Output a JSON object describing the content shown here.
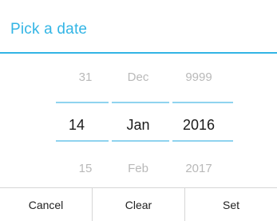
{
  "dialog": {
    "title": "Pick a date"
  },
  "picker": {
    "day": {
      "prev": "31",
      "current": "14",
      "next": "15"
    },
    "month": {
      "prev": "Dec",
      "current": "Jan",
      "next": "Feb"
    },
    "year": {
      "prev": "9999",
      "current": "2016",
      "next": "2017"
    }
  },
  "buttons": {
    "cancel": "Cancel",
    "clear": "Clear",
    "set": "Set"
  },
  "colors": {
    "accent": "#33b5e5",
    "selection_line": "#8fd3ef",
    "faded_text": "#b9b9b9",
    "current_text": "#1a1a1a"
  }
}
